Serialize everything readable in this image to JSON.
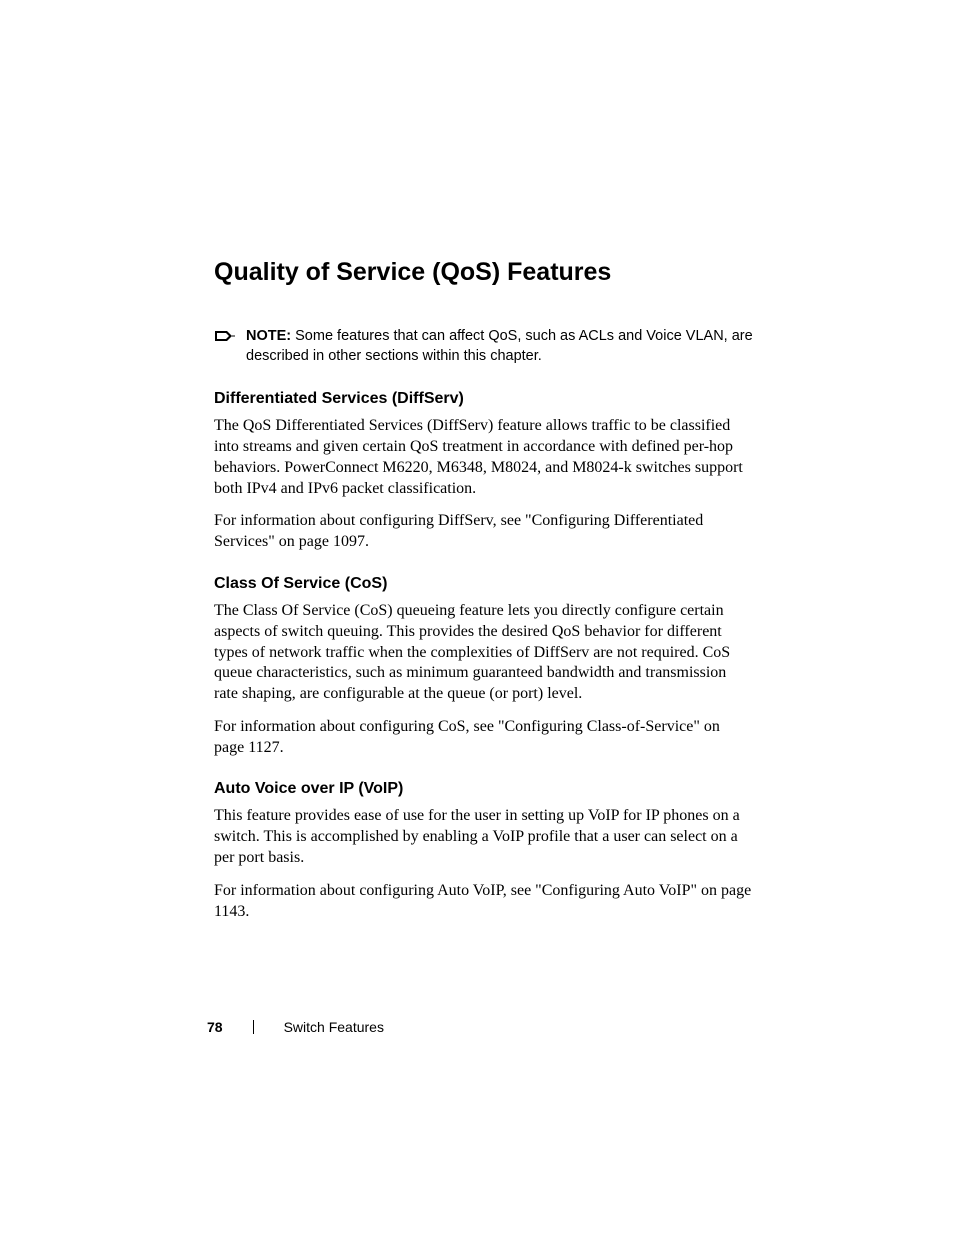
{
  "heading": "Quality of Service (QoS) Features",
  "note": {
    "label": "NOTE:",
    "text": "Some features that can affect QoS, such as ACLs and Voice VLAN, are described in other sections within this chapter."
  },
  "sections": [
    {
      "title": "Differentiated Services (DiffServ)",
      "paragraphs": [
        "The QoS Differentiated Services (DiffServ) feature allows traffic to be classified into streams and given certain QoS treatment in accordance with defined per-hop behaviors. PowerConnect M6220, M6348, M8024, and M8024-k switches support both IPv4 and IPv6 packet classification.",
        "For information about configuring DiffServ, see \"Configuring Differentiated Services\" on page 1097."
      ]
    },
    {
      "title": "Class Of Service (CoS)",
      "paragraphs": [
        "The Class Of Service (CoS) queueing feature lets you directly configure certain aspects of switch queuing. This provides the desired QoS behavior for different types of network traffic when the complexities of DiffServ are not required. CoS queue characteristics, such as minimum guaranteed bandwidth and transmission rate shaping, are configurable at the queue (or port) level.",
        "For information about configuring CoS, see \"Configuring Class-of-Service\" on page 1127."
      ]
    },
    {
      "title": "Auto Voice over IP (VoIP)",
      "paragraphs": [
        "This feature provides ease of use for the user in setting up VoIP for IP phones on a switch. This is accomplished by enabling a VoIP profile that a user can select on a per port basis.",
        "For information about configuring Auto VoIP, see \"Configuring Auto VoIP\" on page 1143."
      ]
    }
  ],
  "footer": {
    "page": "78",
    "title": "Switch Features"
  }
}
